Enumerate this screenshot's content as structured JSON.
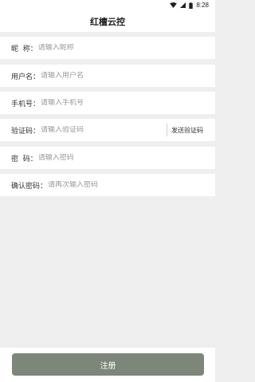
{
  "status": {
    "time": "8:28",
    "icons": [
      "wifi-icon",
      "signal-icon",
      "battery-icon"
    ]
  },
  "header": {
    "title": "红檀云控"
  },
  "form": {
    "nickname": {
      "label": "昵  称：",
      "placeholder": "请输入昵称"
    },
    "username": {
      "label": "用户名：",
      "placeholder": "请输入用户名"
    },
    "phone": {
      "label": "手机号：",
      "placeholder": "请输入手机号"
    },
    "code": {
      "label": "验证码：",
      "placeholder": "请输入验证码",
      "send_label": "发送验证码"
    },
    "password": {
      "label": "密  码：",
      "placeholder": "请输入密码"
    },
    "confirm": {
      "label": "确认密码：",
      "placeholder": "请再次输入密码"
    }
  },
  "register_label": "注册",
  "colors": {
    "button": "#7c8679",
    "background": "#efefef"
  }
}
